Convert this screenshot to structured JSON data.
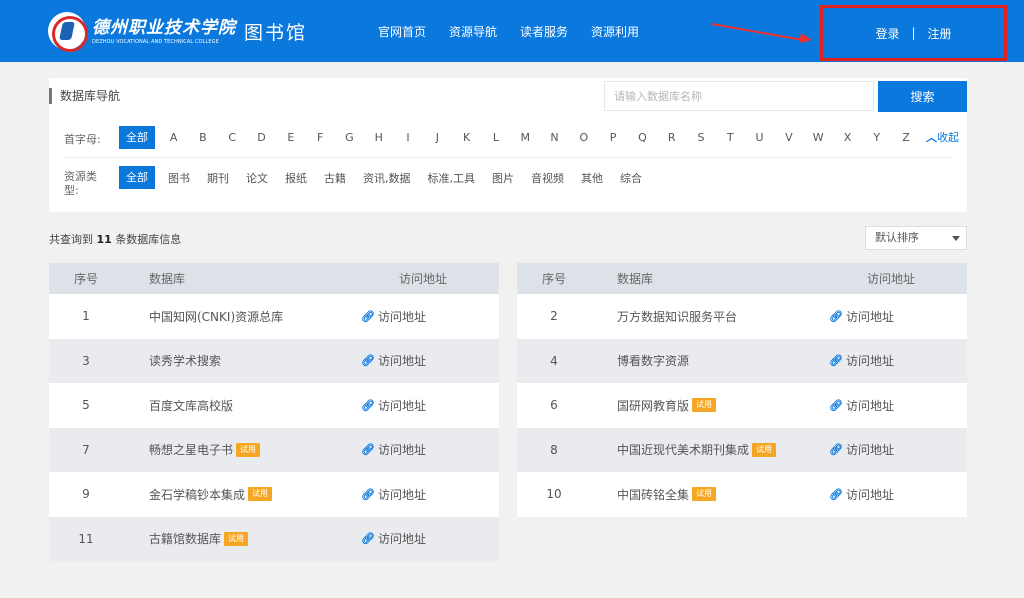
{
  "header": {
    "logo_cn": "德州职业技术学院",
    "logo_en": "DEZHOU VOCATIONAL AND TECHNICAL COLLEGE",
    "logo_lib": "图书馆",
    "nav": [
      "官网首页",
      "资源导航",
      "读者服务",
      "资源利用"
    ],
    "login": "登录",
    "separator": "|",
    "register": "注册"
  },
  "filter": {
    "title": "数据库导航",
    "search_placeholder": "请输入数据库名称",
    "search_button": "搜索",
    "letter_label": "首字母:",
    "all_label": "全部",
    "letters": [
      "A",
      "B",
      "C",
      "D",
      "E",
      "F",
      "G",
      "H",
      "I",
      "J",
      "K",
      "L",
      "M",
      "N",
      "O",
      "P",
      "Q",
      "R",
      "S",
      "T",
      "U",
      "V",
      "W",
      "X",
      "Y",
      "Z"
    ],
    "collapse": "收起",
    "type_label_line1": "资源类",
    "type_label_line2": "型:",
    "types": [
      "图书",
      "期刊",
      "论文",
      "报纸",
      "古籍",
      "资讯,数据",
      "标准,工具",
      "图片",
      "音视频",
      "其他",
      "综合"
    ]
  },
  "results": {
    "prefix": "共查询到",
    "count": "11",
    "suffix": "条数据库信息",
    "sort": "默认排序"
  },
  "table": {
    "headers": [
      "序号",
      "数据库",
      "访问地址"
    ],
    "link_text": "访问地址",
    "trial_badge": "试用",
    "left": [
      {
        "no": "1",
        "name": "中国知网(CNKI)资源总库",
        "trial": false
      },
      {
        "no": "3",
        "name": "读秀学术搜索",
        "trial": false
      },
      {
        "no": "5",
        "name": "百度文库高校版",
        "trial": false
      },
      {
        "no": "7",
        "name": "畅想之星电子书",
        "trial": true
      },
      {
        "no": "9",
        "name": "金石学稿钞本集成",
        "trial": true
      },
      {
        "no": "11",
        "name": "古籍馆数据库",
        "trial": true
      }
    ],
    "right": [
      {
        "no": "2",
        "name": "万方数据知识服务平台",
        "trial": false
      },
      {
        "no": "4",
        "name": "博看数字资源",
        "trial": false
      },
      {
        "no": "6",
        "name": "国研网教育版",
        "trial": true
      },
      {
        "no": "8",
        "name": "中国近现代美术期刊集成",
        "trial": true
      },
      {
        "no": "10",
        "name": "中国砖铭全集",
        "trial": true
      }
    ]
  },
  "colors": {
    "primary": "#0a78dc",
    "annotation": "#e32020",
    "badge": "#f5a623"
  }
}
